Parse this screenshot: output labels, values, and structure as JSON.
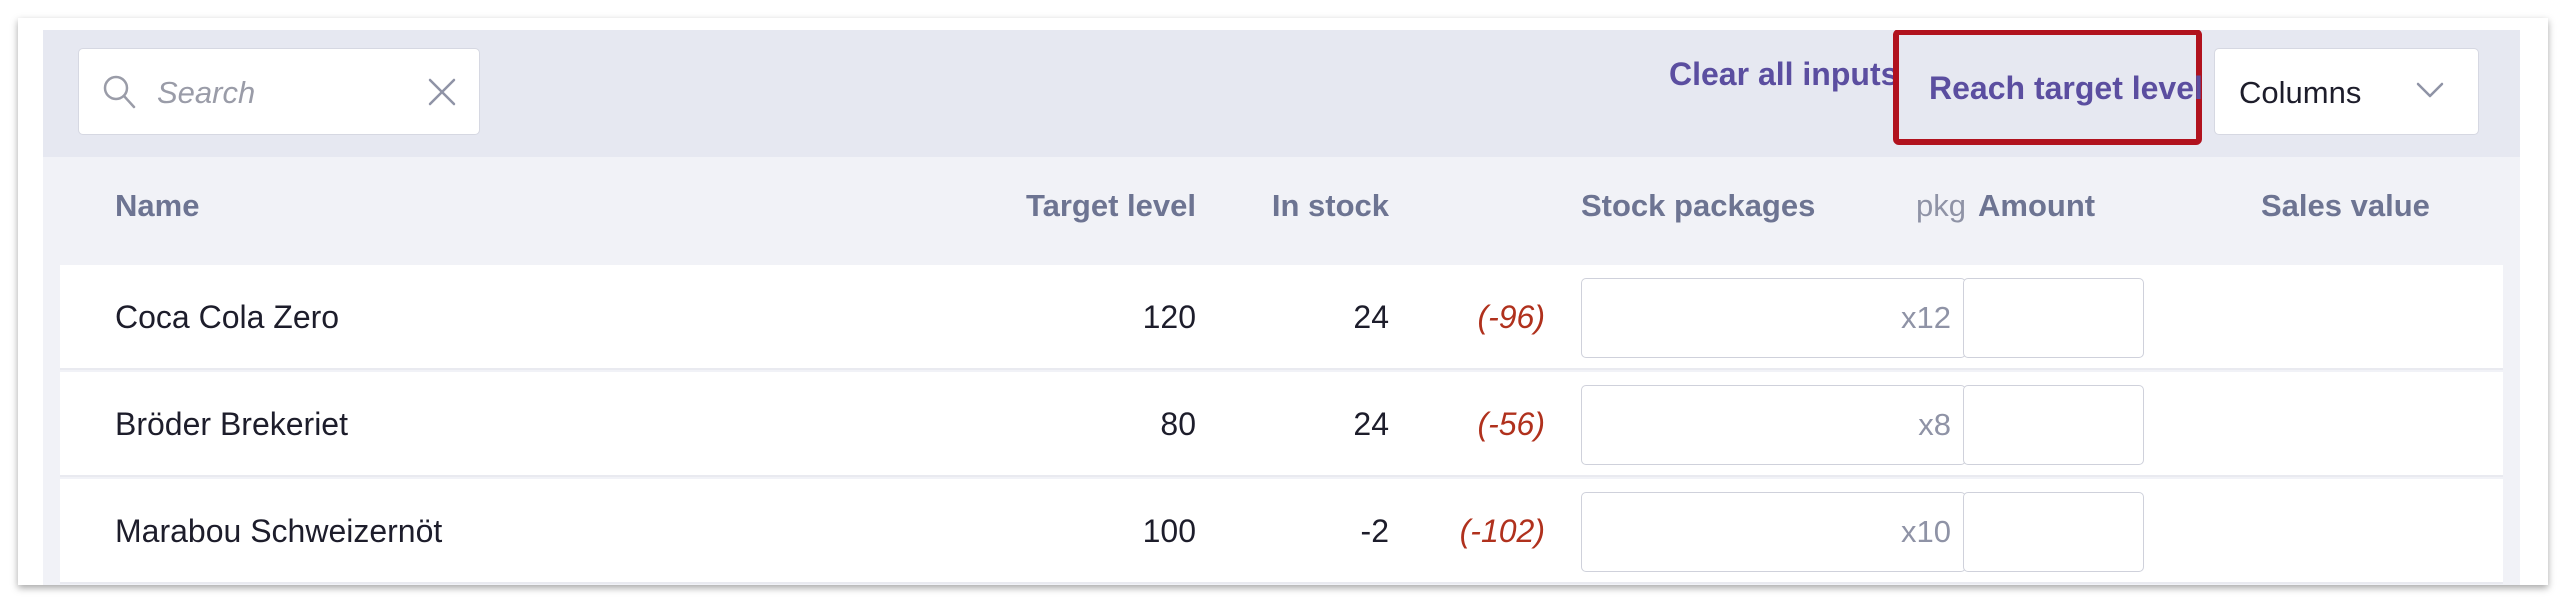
{
  "toolbar": {
    "search_placeholder": "Search",
    "clear_all_label": "Clear all inputs",
    "reach_target_label": "Reach target level",
    "columns_label": "Columns"
  },
  "table": {
    "headers": {
      "name": "Name",
      "target_level": "Target level",
      "in_stock": "In stock",
      "stock_packages": "Stock packages",
      "pkg": "pkg",
      "amount": "Amount",
      "sales_value": "Sales value"
    },
    "rows": [
      {
        "name": "Coca Cola Zero",
        "target": "120",
        "stock": "24",
        "diff": "(-96)",
        "pkg_size": "x12",
        "amount": ""
      },
      {
        "name": "Bröder Brekeriet",
        "target": "80",
        "stock": "24",
        "diff": "(-56)",
        "pkg_size": "x8",
        "amount": ""
      },
      {
        "name": "Marabou Schweizernöt",
        "target": "100",
        "stock": "-2",
        "diff": "(-102)",
        "pkg_size": "x10",
        "amount": ""
      }
    ]
  },
  "colors": {
    "accent": "#5b4ea0",
    "highlight_border": "#b1121e",
    "negative": "#b0311d"
  }
}
